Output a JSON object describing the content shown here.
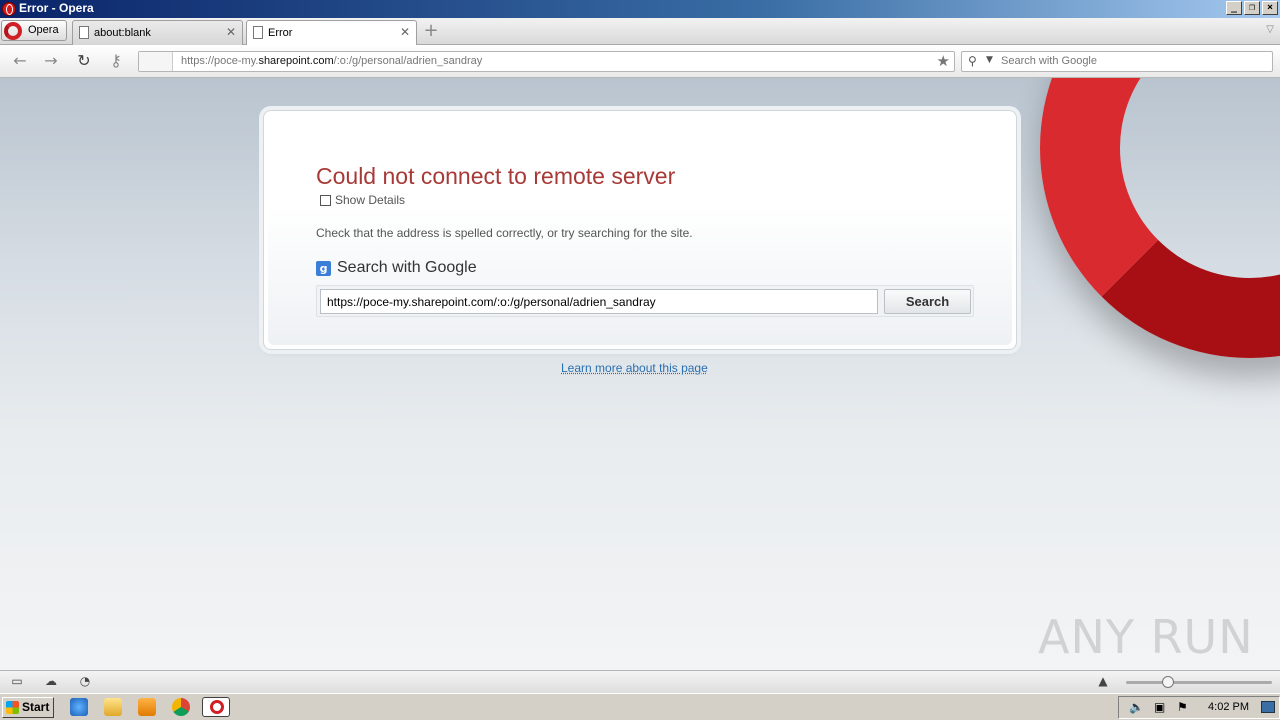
{
  "window": {
    "title": "Error - Opera"
  },
  "tabs": {
    "menu_label": "Opera",
    "items": [
      {
        "label": "about:blank"
      },
      {
        "label": "Error"
      }
    ]
  },
  "address": {
    "url_prefix": "https://poce-my.",
    "url_domain": "sharepoint.com",
    "url_suffix": "/:o:/g/personal/adrien_sandray"
  },
  "search": {
    "placeholder": "Search with Google"
  },
  "error": {
    "title": "Could not connect to remote server",
    "show_details": "Show Details",
    "hint": "Check that the address is spelled correctly, or try searching for the site.",
    "search_heading": "Search with Google",
    "search_value": "https://poce-my.sharepoint.com/:o:/g/personal/adrien_sandray",
    "search_button": "Search",
    "learn_more": "Learn more about this page"
  },
  "watermark": "ANY RUN",
  "taskbar": {
    "start_label": "Start",
    "clock": "4:02 PM"
  },
  "colors": {
    "error_title": "#a73a37",
    "link": "#2a6fb0",
    "opera_red": "#c8151c"
  }
}
